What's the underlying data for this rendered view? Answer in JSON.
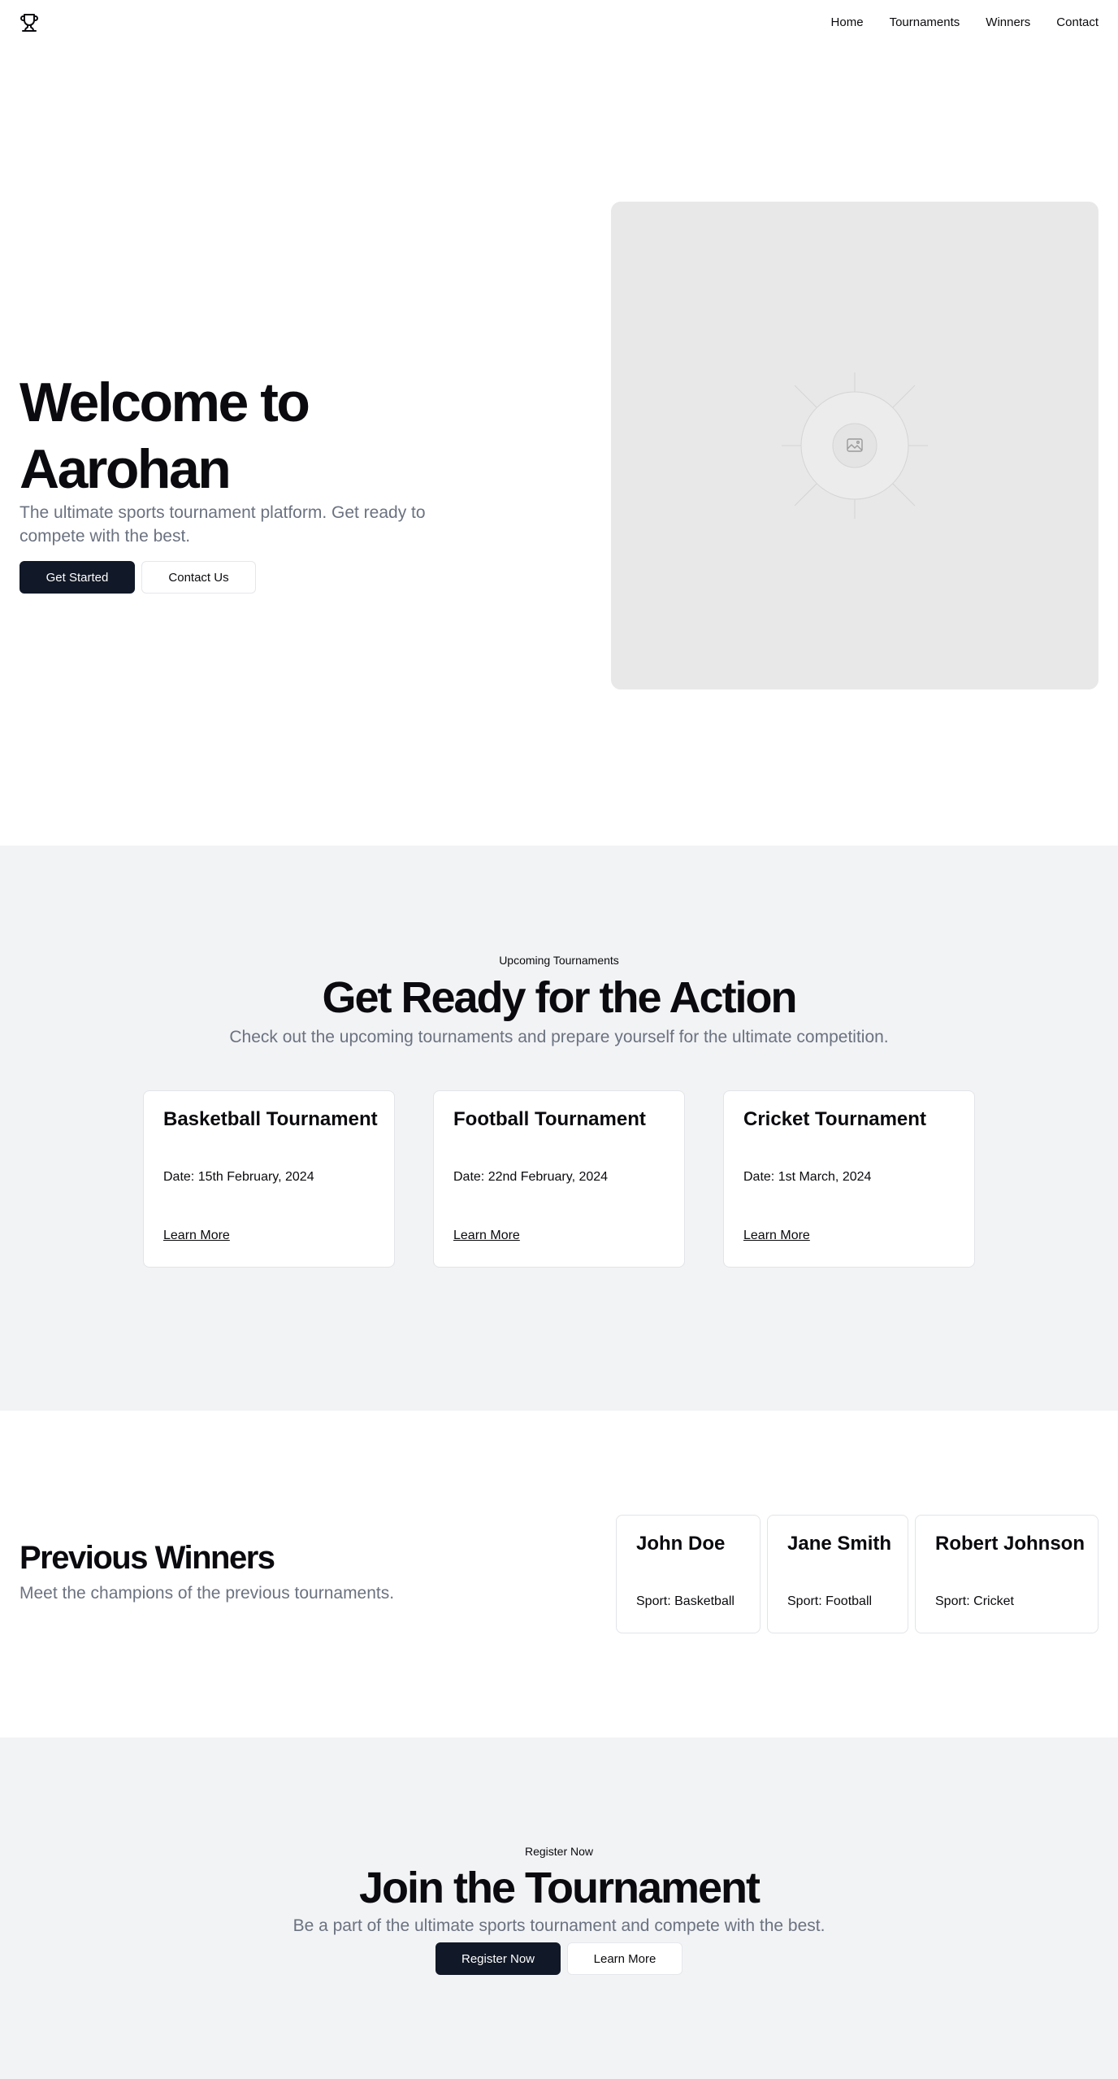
{
  "nav": {
    "items": [
      "Home",
      "Tournaments",
      "Winners",
      "Contact"
    ]
  },
  "hero": {
    "title": "Welcome to Aarohan",
    "subtitle": "The ultimate sports tournament platform. Get ready to compete with the best.",
    "primary_button": "Get Started",
    "secondary_button": "Contact Us"
  },
  "tournaments": {
    "eyebrow": "Upcoming Tournaments",
    "title": "Get Ready for the Action",
    "subtitle": "Check out the upcoming tournaments and prepare yourself for the ultimate competition.",
    "cards": [
      {
        "title": "Basketball Tournament",
        "date": "Date: 15th February, 2024",
        "link": "Learn More"
      },
      {
        "title": "Football Tournament",
        "date": "Date: 22nd February, 2024",
        "link": "Learn More"
      },
      {
        "title": "Cricket Tournament",
        "date": "Date: 1st March, 2024",
        "link": "Learn More"
      }
    ]
  },
  "winners": {
    "title": "Previous Winners",
    "subtitle": "Meet the champions of the previous tournaments.",
    "cards": [
      {
        "name": "John Doe",
        "sport": "Sport: Basketball"
      },
      {
        "name": "Jane Smith",
        "sport": "Sport: Football"
      },
      {
        "name": "Robert Johnson",
        "sport": "Sport: Cricket"
      }
    ]
  },
  "register": {
    "eyebrow": "Register Now",
    "title": "Join the Tournament",
    "subtitle": "Be a part of the ultimate sports tournament and compete with the best.",
    "primary_button": "Register Now",
    "secondary_button": "Learn More"
  },
  "icons": {
    "logo": "trophy-icon",
    "hero_image": "image-placeholder-icon"
  },
  "colors": {
    "primary": "#111827",
    "muted_text": "#6b7280",
    "section_bg": "#f2f3f5",
    "placeholder_bg": "#e8e8e8"
  }
}
